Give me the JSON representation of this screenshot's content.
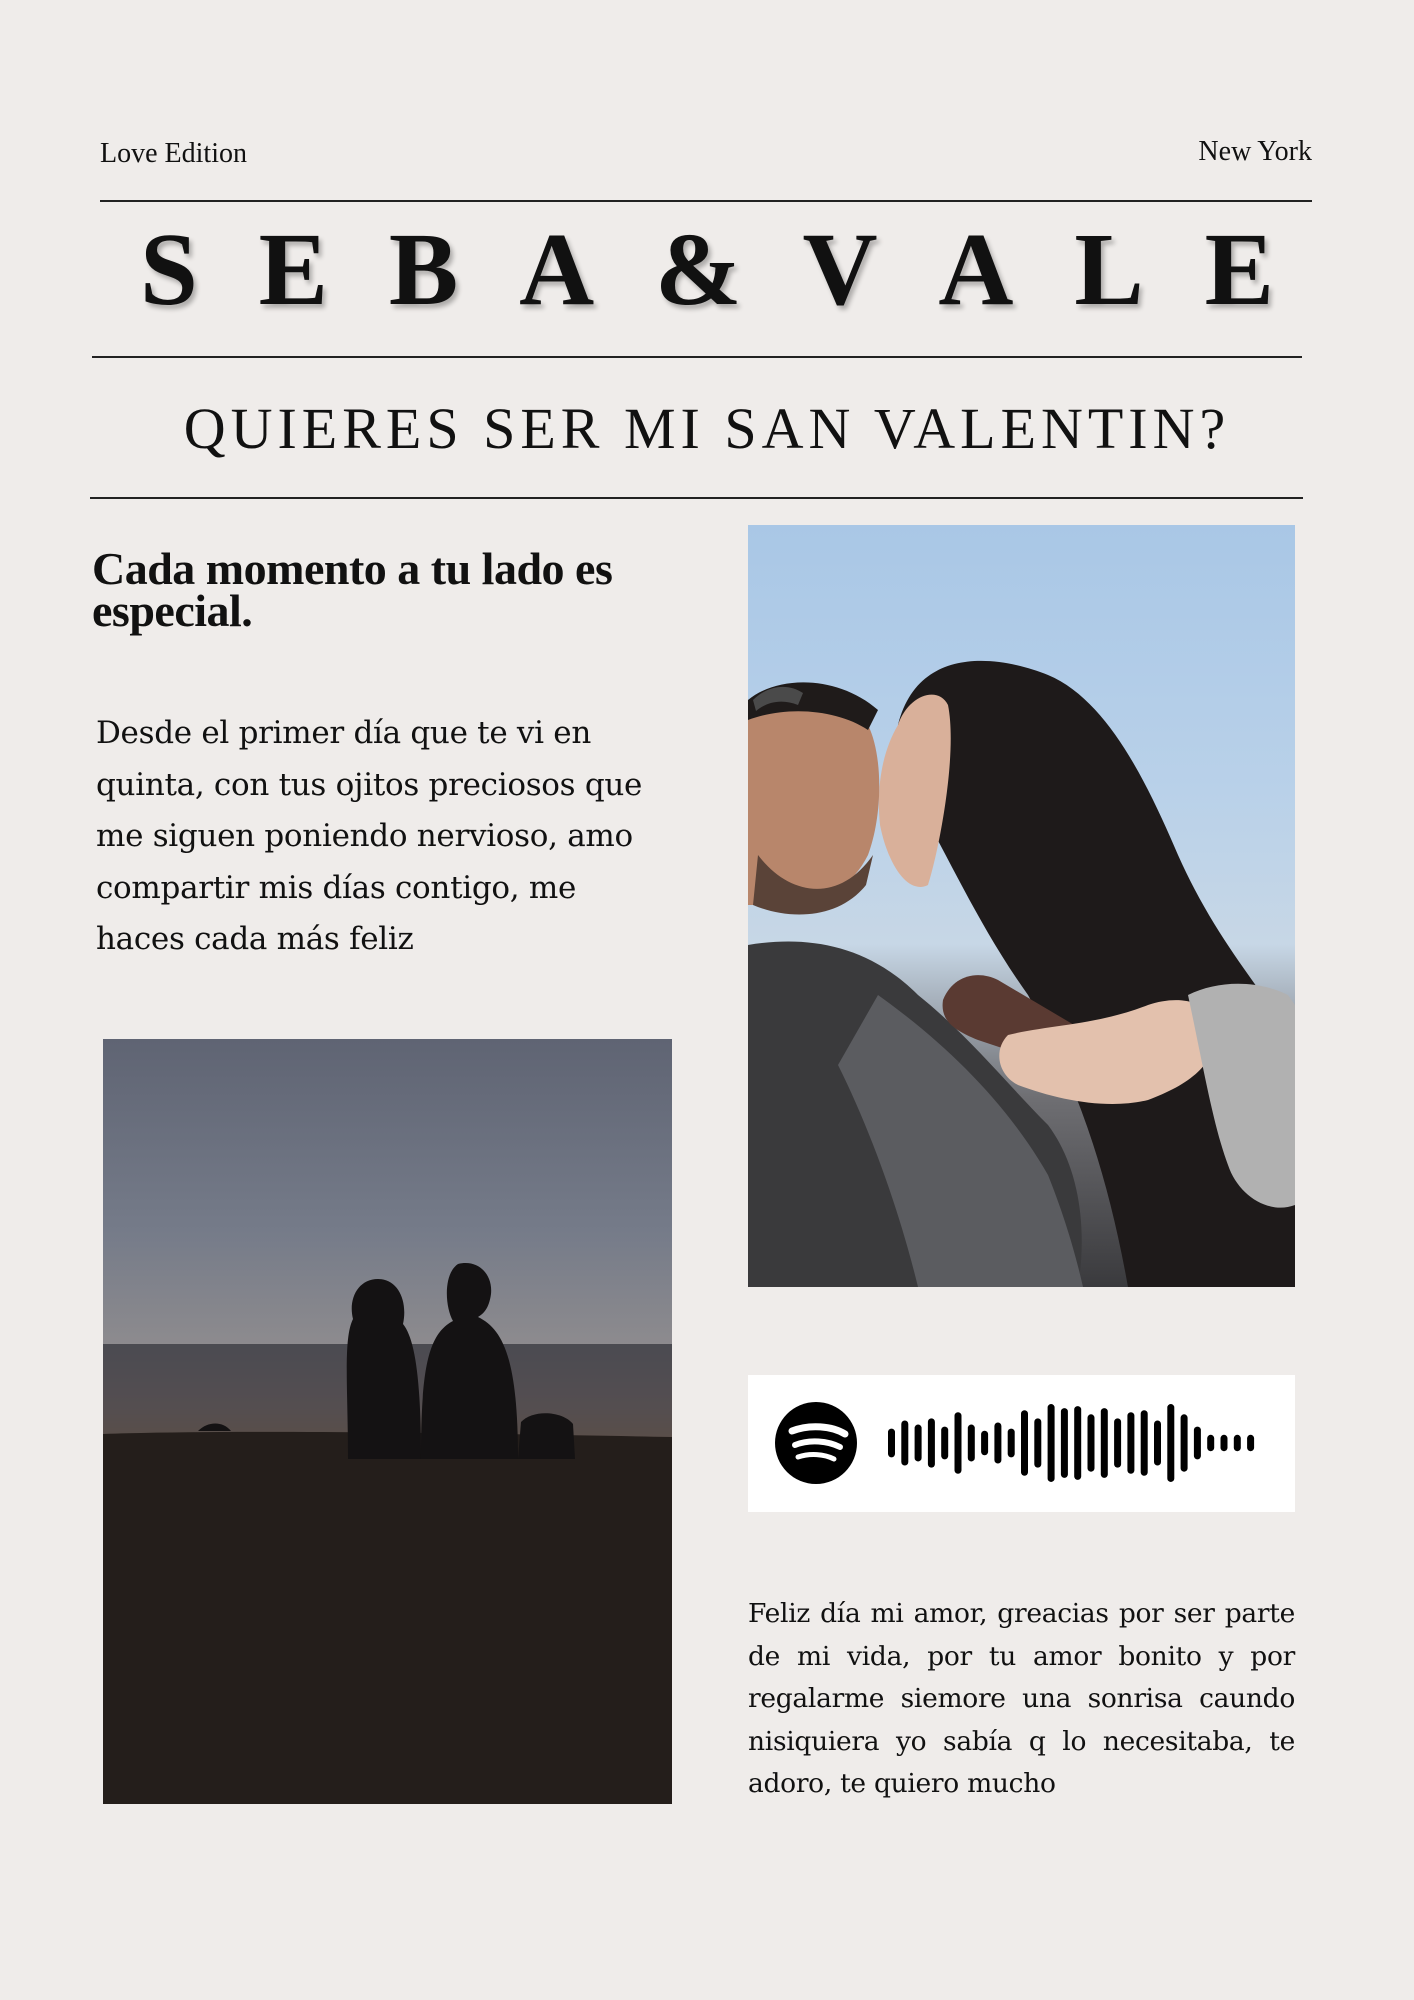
{
  "header": {
    "edition": "Love Edition",
    "city": "New York"
  },
  "masthead": {
    "letters": [
      "S",
      "E",
      "B",
      "A",
      "&",
      "V",
      "A",
      "L",
      "E"
    ]
  },
  "question": "QUIERES SER MI SAN VALENTIN?",
  "article": {
    "headline_line1": "Cada momento a tu lado es",
    "headline_line2": "especial.",
    "lead_lines": [
      "Desde el primer día que te vi en",
      "quinta, con tus ojitos preciosos que",
      "me siguen poniendo nervioso, amo",
      "compartir mis días contigo, me",
      "haces cada más feliz"
    ]
  },
  "spotify": {
    "icon": "spotify-icon",
    "bar_heights": [
      0.35,
      0.55,
      0.45,
      0.6,
      0.4,
      0.75,
      0.45,
      0.3,
      0.5,
      0.35,
      0.8,
      0.6,
      0.95,
      0.85,
      0.9,
      0.7,
      0.85,
      0.6,
      0.75,
      0.8,
      0.55,
      0.95,
      0.7,
      0.4,
      0.2,
      0.2,
      0.2,
      0.2
    ]
  },
  "closing": "Feliz día mi amor, greacias por ser parte de mi vida, por tu amor bonito y por regalarme siemore una sonrisa caundo nisiquiera yo sabía q lo necesitaba, te adoro, te quiero mucho"
}
